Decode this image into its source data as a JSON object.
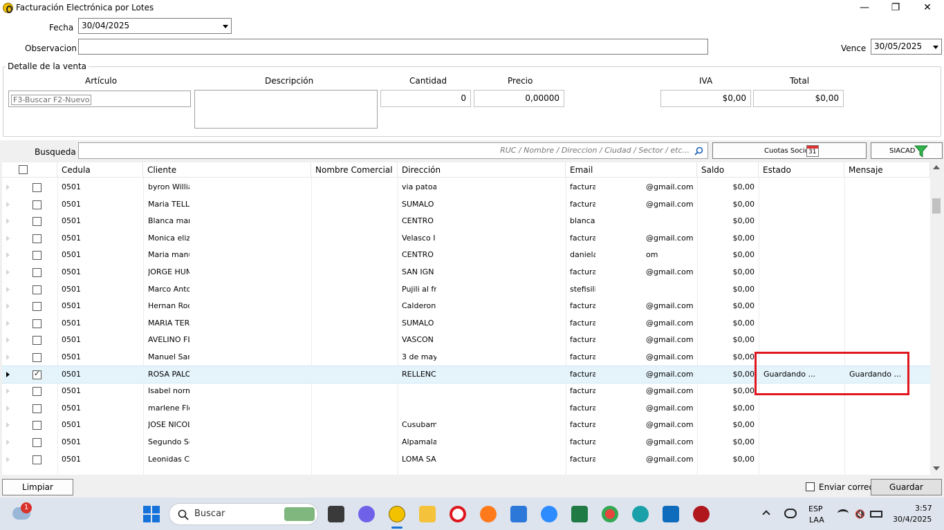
{
  "window": {
    "title": "Facturación Electrónica por Lotes",
    "controls": {
      "minimize": "—",
      "maximize": "❐",
      "close": "✕"
    }
  },
  "form": {
    "fecha_label": "Fecha",
    "fecha_value": "30/04/2025",
    "observacion_label": "Observacion",
    "observacion_value": "",
    "vence_label": "Vence",
    "vence_value": "30/05/2025"
  },
  "detalle": {
    "title": "Detalle de la venta",
    "articulo_label": "Artículo",
    "articulo_placeholder": "F3-Buscar F2-Nuevo",
    "descripcion_label": "Descripción",
    "cantidad_label": "Cantidad",
    "cantidad_value": "0",
    "precio_label": "Precio",
    "precio_value": "0,00000",
    "iva_label": "IVA",
    "iva_value": "$0,00",
    "total_label": "Total",
    "total_value": "$0,00"
  },
  "busqueda": {
    "label": "Busqueda",
    "placeholder": "RUC / Nombre / Direccion / Ciudad / Sector / etc...",
    "cuotas_label": "Cuotas Socios",
    "calendar_day": "31",
    "siacad_label": "SIACAD"
  },
  "grid": {
    "columns": [
      "Cedula",
      "Cliente",
      "Nombre Comercial",
      "Dirección",
      "Email",
      "Saldo",
      "Estado",
      "Mensaje"
    ],
    "rows": [
      {
        "cedula": "0501",
        "cliente": "byron Willia",
        "direccion": "via patoa",
        "email_a": "factura",
        "email_b": "@gmail.com",
        "saldo": "$0,00",
        "estado": "",
        "mensaje": "",
        "checked": false
      },
      {
        "cedula": "0501",
        "cliente": "Maria TELLC",
        "direccion": "SUMALO",
        "email_a": "factura",
        "email_b": "@gmail.com",
        "saldo": "$0,00",
        "estado": "",
        "mensaje": "",
        "checked": false
      },
      {
        "cedula": "0501",
        "cliente": "Blanca mari",
        "direccion": "CENTRO",
        "email_a": "blancap",
        "email_b": "",
        "saldo": "$0,00",
        "estado": "",
        "mensaje": "",
        "checked": false
      },
      {
        "cedula": "0501",
        "cliente": "Monica eliza",
        "direccion": "Velasco I",
        "email_a": "factura",
        "email_b": "@gmail.com",
        "saldo": "$0,00",
        "estado": "",
        "mensaje": "",
        "checked": false
      },
      {
        "cedula": "0501",
        "cliente": "Maria manu",
        "direccion": "CENTRO",
        "email_a": "daniela",
        "email_b": "om",
        "saldo": "$0,00",
        "estado": "",
        "mensaje": "",
        "checked": false
      },
      {
        "cedula": "0501",
        "cliente": "JORGE HUM",
        "direccion": "SAN IGN",
        "email_a": "factura",
        "email_b": "@gmail.com",
        "saldo": "$0,00",
        "estado": "",
        "mensaje": "",
        "checked": false
      },
      {
        "cedula": "0501",
        "cliente": "Marco Anto",
        "direccion": "Pujili al fr",
        "email_a": "stefisili",
        "email_b": "",
        "saldo": "$0,00",
        "estado": "",
        "mensaje": "",
        "checked": false
      },
      {
        "cedula": "0501",
        "cliente": "Hernan Rod",
        "direccion": "Calderon",
        "email_a": "factura",
        "email_b": "@gmail.com",
        "saldo": "$0,00",
        "estado": "",
        "mensaje": "",
        "checked": false
      },
      {
        "cedula": "0501",
        "cliente": "MARIA TERE",
        "direccion": "SUMALO",
        "email_a": "factura",
        "email_b": "@gmail.com",
        "saldo": "$0,00",
        "estado": "",
        "mensaje": "",
        "checked": false
      },
      {
        "cedula": "0501",
        "cliente": "AVELINO FL",
        "direccion": "VASCON",
        "email_a": "factura",
        "email_b": "@gmail.com",
        "saldo": "$0,00",
        "estado": "",
        "mensaje": "",
        "checked": false
      },
      {
        "cedula": "0501",
        "cliente": "Manuel San",
        "direccion": "3 de may",
        "email_a": "factura",
        "email_b": "@gmail.com",
        "saldo": "$0,00",
        "estado": "",
        "mensaje": "",
        "checked": false
      },
      {
        "cedula": "0501",
        "cliente": "ROSA PALO",
        "direccion": "RELLENC",
        "email_a": "factura",
        "email_b": "@gmail.com",
        "saldo": "$0,00",
        "estado": "Guardando ...",
        "mensaje": "Guardando ...",
        "checked": true,
        "selected": true
      },
      {
        "cedula": "0501",
        "cliente": "Isabel norm",
        "direccion": "",
        "email_a": "factura",
        "email_b": "@gmail.com",
        "saldo": "$0,00",
        "estado": "",
        "mensaje": "",
        "checked": false
      },
      {
        "cedula": "0501",
        "cliente": "marlene Flo",
        "direccion": "",
        "email_a": "factura",
        "email_b": "@gmail.com",
        "saldo": "$0,00",
        "estado": "",
        "mensaje": "",
        "checked": false
      },
      {
        "cedula": "0501",
        "cliente": "JOSE NICOL",
        "direccion": "Cusubam",
        "email_a": "factura",
        "email_b": "@gmail.com",
        "saldo": "$0,00",
        "estado": "",
        "mensaje": "",
        "checked": false
      },
      {
        "cedula": "0501",
        "cliente": "Segundo Sc",
        "direccion": "Alpamala",
        "email_a": "factura",
        "email_b": "@gmail.com",
        "saldo": "$0,00",
        "estado": "",
        "mensaje": "",
        "checked": false
      },
      {
        "cedula": "0501",
        "cliente": "Leonidas Cu",
        "direccion": "LOMA SA",
        "email_a": "factura",
        "email_b": "@gmail.com",
        "saldo": "$0,00",
        "estado": "",
        "mensaje": "",
        "checked": false
      }
    ]
  },
  "bottom": {
    "limpiar": "Limpiar",
    "enviar_correo": "Enviar correo",
    "guardar": "Guardar"
  },
  "taskbar": {
    "search_placeholder": "Buscar",
    "weather_badge": "1",
    "lang_top": "ESP",
    "lang_bottom": "LAA",
    "time": "3:57",
    "date": "30/4/2025"
  },
  "colors": {
    "highlight_box": "#e0161e",
    "selected_row": "#e5f3fb",
    "taskbar": "#dde4ee"
  }
}
